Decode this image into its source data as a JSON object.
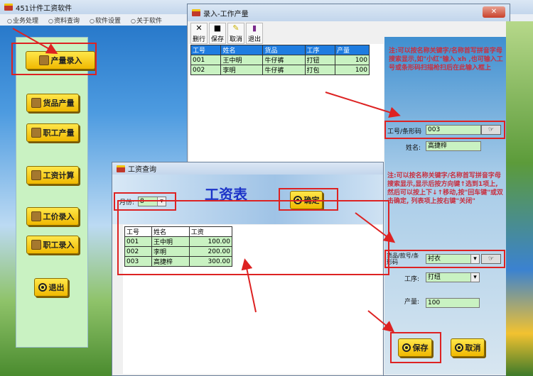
{
  "main_window": {
    "title": "451计件工资软件",
    "menu": [
      "业务处理",
      "资料查询",
      "软件设置",
      "关于软件"
    ],
    "sidebar_buttons": [
      "产量录入",
      "货品产量",
      "职工产量",
      "工资计算",
      "工价录入",
      "职工录入",
      "退出"
    ]
  },
  "production_window": {
    "title": "录入-工作产量",
    "toolbar": [
      "删行",
      "保存",
      "取消",
      "退出"
    ],
    "table": {
      "columns": [
        "工号",
        "姓名",
        "货品",
        "工序",
        "产量"
      ],
      "rows": [
        [
          "001",
          "王中明",
          "牛仔裤",
          "打钮",
          "100"
        ],
        [
          "002",
          "李明",
          "牛仔裤",
          "打包",
          "100"
        ]
      ]
    },
    "note1": "注:可以按名称关键字/名称首写拼音字母搜索显示,如\"小红\"输入 xh ,也可输入工号或条形码扫描枪扫后在此输入框上",
    "worker_id_label": "工号/条形码",
    "worker_id_value": "003",
    "name_label": "姓名:",
    "name_value": "高捷梓",
    "note2": "注:可以按名称关键字/名称首写拼音字母搜索显示,显示后按方向键↑选到1项上,然后可以按上下↓↑移动,按\"回车键\"或双击确定,  列表项上按右键\"关闭\"",
    "product_label": "货品/款号/条形码",
    "product_value": "衬衣",
    "process_label": "工序:",
    "process_value": "打纽",
    "quantity_label": "产量:",
    "quantity_value": "100",
    "save_label": "保存",
    "cancel_label": "取消"
  },
  "wage_window": {
    "title": "工资查询",
    "heading": "工资表",
    "month_label": "月份:",
    "month_value": "8",
    "confirm_label": "确定",
    "table": {
      "columns": [
        "工号",
        "姓名",
        "工资"
      ],
      "rows": [
        [
          "001",
          "王中明",
          "100.00"
        ],
        [
          "002",
          "李明",
          "200.00"
        ],
        [
          "003",
          "高捷梓",
          "300.00"
        ]
      ]
    }
  }
}
